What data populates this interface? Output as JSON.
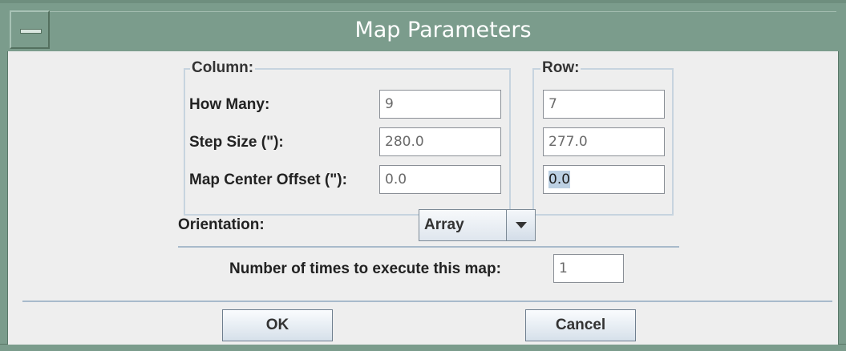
{
  "window": {
    "title": "Map Parameters"
  },
  "column": {
    "group_label": "Column:",
    "how_many": "9",
    "step_size": "280.0",
    "center_offset": "0.0"
  },
  "row": {
    "group_label": "Row:",
    "how_many": "7",
    "step_size": "277.0",
    "center_offset": "0.0"
  },
  "labels": {
    "how_many": "How Many:",
    "step_size": "Step Size (\"):",
    "center_offset": "Map Center Offset (\"):",
    "orientation": "Orientation:",
    "repeat": "Number of times to execute this map:"
  },
  "orientation": {
    "selected": "Array"
  },
  "repeat": {
    "value": "1"
  },
  "buttons": {
    "ok": "OK",
    "cancel": "Cancel"
  },
  "icons": {
    "window_menu": "window-menu-icon",
    "dropdown": "chevron-down-icon"
  },
  "colors": {
    "titlebar": "#7b9c8c",
    "background": "#eeeeee",
    "group_border": "#c7d4df"
  }
}
